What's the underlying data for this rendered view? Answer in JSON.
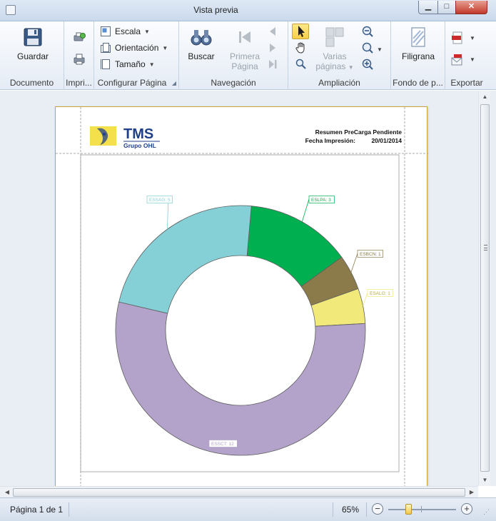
{
  "window": {
    "title": "Vista previa",
    "controls": [
      "minimize",
      "maximize",
      "close"
    ]
  },
  "ribbon": {
    "documento": {
      "label": "Documento",
      "guardar": "Guardar"
    },
    "imprimir": {
      "label": "Impri..."
    },
    "configurar": {
      "label": "Configurar Página",
      "escala": "Escala",
      "orientacion": "Orientación",
      "tamano": "Tamaño"
    },
    "navegacion": {
      "label": "Navegación",
      "buscar": "Buscar",
      "primera_pagina_1": "Primera",
      "primera_pagina_2": "Página"
    },
    "ampliacion": {
      "label": "Ampliación",
      "varias_paginas_1": "Varias",
      "varias_paginas_2": "páginas"
    },
    "fondo": {
      "label": "Fondo de p...",
      "filigrana": "Filigrana"
    },
    "exportar": {
      "label": "Exportar"
    }
  },
  "report": {
    "logo_text": "TMS",
    "logo_subtext": "Grupo OHL",
    "title": "Resumen PreCarga Pendiente",
    "date_label": "Fecha Impresión:",
    "date_value": "20/01/2014"
  },
  "chart_data": {
    "type": "pie",
    "donut": true,
    "slices": [
      {
        "label": "ESLPA: 3",
        "value": 3,
        "color": "#00b050"
      },
      {
        "label": "ESBCN: 1",
        "value": 1,
        "color": "#8b7b4a"
      },
      {
        "label": "ESALG: 1",
        "value": 1,
        "color": "#f1e97a"
      },
      {
        "label": "ESSCT: 12",
        "value": 12,
        "color": "#b3a2c9"
      },
      {
        "label": "ESSAG: 5",
        "value": 5,
        "color": "#84d0d6"
      }
    ]
  },
  "status": {
    "page_text": "Página 1 de 1",
    "zoom_text": "65%",
    "zoom_fraction": 0.3
  }
}
